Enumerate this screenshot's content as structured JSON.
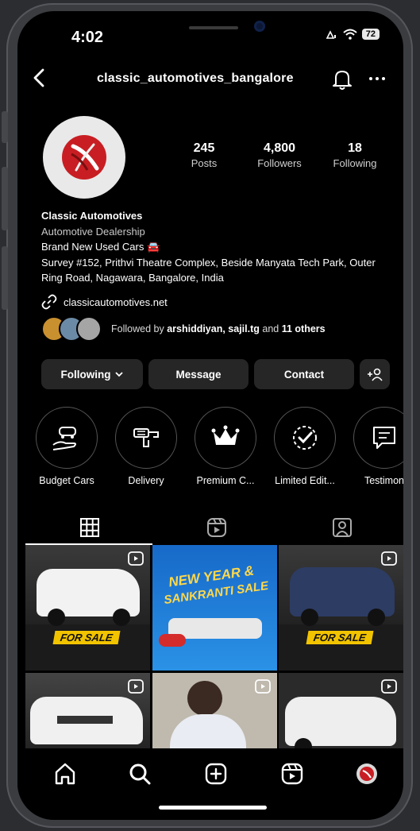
{
  "status_bar": {
    "time": "4:02",
    "battery": "72"
  },
  "header": {
    "username": "classic_automotives_bangalore"
  },
  "profile": {
    "stats": [
      {
        "value": "245",
        "label": "Posts"
      },
      {
        "value": "4,800",
        "label": "Followers"
      },
      {
        "value": "18",
        "label": "Following"
      }
    ],
    "name": "Classic Automotives",
    "category": "Automotive Dealership",
    "bio_line": "Brand New Used Cars 🚘",
    "address": "Survey #152, Prithvi Theatre Complex, Beside Manyata Tech Park, Outer Ring Road, Nagawara, Bangalore, India",
    "website": "classicautomotives.net",
    "followed_prefix": "Followed by ",
    "followed_names": "arshiddiyan, sajil.tg",
    "followed_mid": " and ",
    "followed_others": "11 others"
  },
  "buttons": {
    "following": "Following",
    "message": "Message",
    "contact": "Contact"
  },
  "highlights": [
    {
      "label": "Budget Cars",
      "icon": "hand-car-icon"
    },
    {
      "label": "Delivery",
      "icon": "key-delivery-icon"
    },
    {
      "label": "Premium C...",
      "icon": "crown-icon"
    },
    {
      "label": "Limited Edit...",
      "icon": "check-badge-icon"
    },
    {
      "label": "Testimon",
      "icon": "testimonial-icon"
    }
  ],
  "posts": [
    {
      "badge": "FOR SALE"
    },
    {
      "text_1": "NEW YEAR &",
      "text_2": "SANKRANTI SALE"
    },
    {
      "badge": "FOR SALE"
    },
    {},
    {},
    {}
  ],
  "colors": {
    "background": "#000000",
    "button": "#262626",
    "brand_red": "#c81e23",
    "sale_yellow": "#f2c400"
  }
}
